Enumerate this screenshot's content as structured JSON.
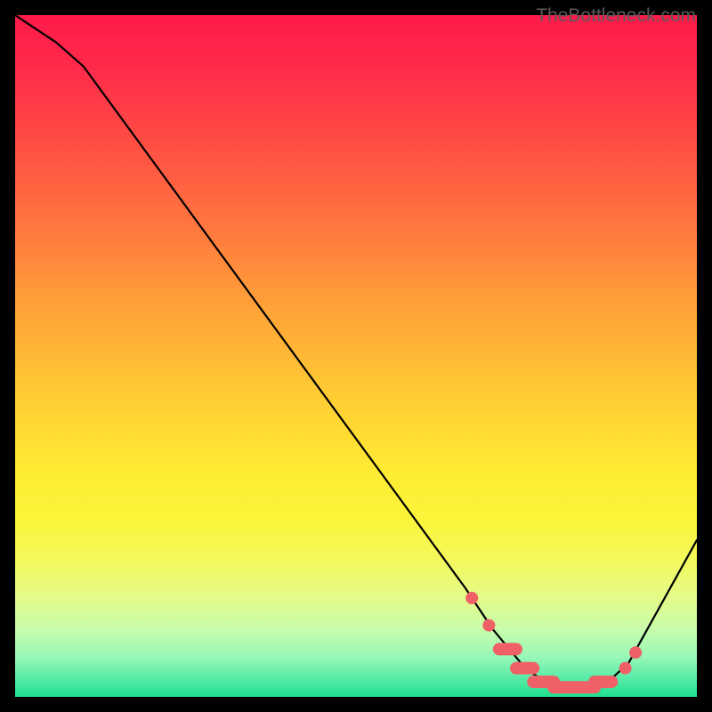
{
  "watermark": "TheBottleneck.com",
  "chart_data": {
    "type": "line",
    "title": "",
    "xlabel": "",
    "ylabel": "",
    "xlim": [
      0,
      100
    ],
    "ylim": [
      0,
      100
    ],
    "curve": [
      {
        "x": 0,
        "y": 100
      },
      {
        "x": 6,
        "y": 96
      },
      {
        "x": 10,
        "y": 92.5
      },
      {
        "x": 66,
        "y": 16
      },
      {
        "x": 70,
        "y": 10
      },
      {
        "x": 75,
        "y": 4
      },
      {
        "x": 79,
        "y": 1.5
      },
      {
        "x": 83,
        "y": 1.2
      },
      {
        "x": 87,
        "y": 2.2
      },
      {
        "x": 90,
        "y": 5
      },
      {
        "x": 100,
        "y": 23
      }
    ],
    "markers": [
      {
        "type": "dot",
        "x": 67,
        "y": 14.5
      },
      {
        "type": "dot",
        "x": 69.5,
        "y": 10.5
      },
      {
        "type": "dash",
        "x1": 71,
        "x2": 73.5,
        "y": 7
      },
      {
        "type": "dash",
        "x1": 73.5,
        "x2": 76,
        "y": 4.2
      },
      {
        "type": "dash",
        "x1": 76,
        "x2": 79,
        "y": 2.2
      },
      {
        "type": "dash",
        "x1": 79,
        "x2": 82,
        "y": 1.4
      },
      {
        "type": "dash",
        "x1": 82,
        "x2": 85,
        "y": 1.4
      },
      {
        "type": "dash",
        "x1": 85,
        "x2": 87.5,
        "y": 2.2
      },
      {
        "type": "dot",
        "x": 89.5,
        "y": 4.2
      },
      {
        "type": "dot",
        "x": 91,
        "y": 6.5
      }
    ],
    "background_gradient": {
      "top": "#ff1a4a",
      "mid": "#ffe933",
      "bottom": "#1ee08e"
    }
  }
}
